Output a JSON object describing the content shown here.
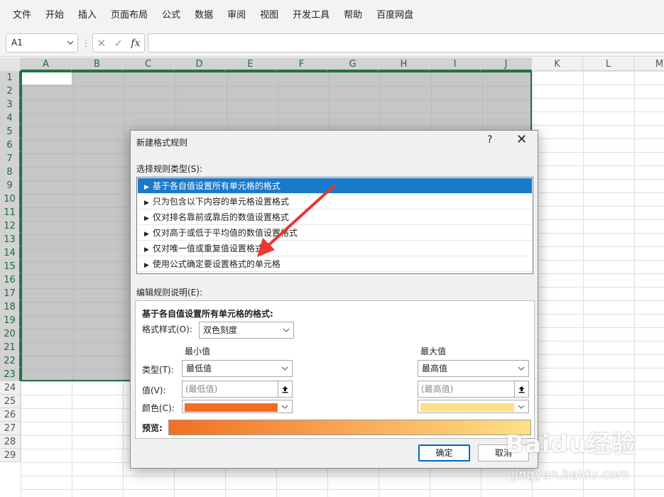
{
  "menubar": {
    "items": [
      "文件",
      "开始",
      "插入",
      "页面布局",
      "公式",
      "数据",
      "审阅",
      "视图",
      "开发工具",
      "帮助",
      "百度网盘"
    ]
  },
  "formulabar": {
    "namebox": "A1",
    "separator": "⋮",
    "cancel_icon": "✕",
    "enter_icon": "✓",
    "fx_label": "fx",
    "formula_value": ""
  },
  "sheet": {
    "columns": [
      "A",
      "B",
      "C",
      "D",
      "E",
      "F",
      "G",
      "H",
      "I",
      "J",
      "K",
      "L",
      "M"
    ],
    "rows": [
      "1",
      "2",
      "3",
      "4",
      "5",
      "6",
      "7",
      "8",
      "9",
      "10",
      "11",
      "12",
      "13",
      "14",
      "15",
      "16",
      "17",
      "18",
      "19",
      "20",
      "21",
      "22",
      "23",
      "24",
      "25",
      "26",
      "27",
      "28",
      "29"
    ],
    "selected_range": "A1:J23"
  },
  "dialog": {
    "title": "新建格式规则",
    "help": "?",
    "close": "✕",
    "rule_type_label": "选择规则类型(S):",
    "rule_types": [
      "基于各自值设置所有单元格的格式",
      "只为包含以下内容的单元格设置格式",
      "仅对排名靠前或靠后的数值设置格式",
      "仅对高于或低于平均值的数值设置格式",
      "仅对唯一值或重复值设置格式",
      "使用公式确定要设置格式的单元格"
    ],
    "selected_rule_index": 0,
    "edit_label": "编辑规则说明(E):",
    "desc_heading": "基于各自值设置所有单元格的格式:",
    "format_style_label": "格式样式(O):",
    "format_style_value": "双色刻度",
    "min_heading": "最小值",
    "max_heading": "最大值",
    "type_label": "类型(T):",
    "value_label": "值(V):",
    "color_label": "颜色(C):",
    "min_type": "最低值",
    "max_type": "最高值",
    "min_value_placeholder": "(最低值)",
    "max_value_placeholder": "(最高值)",
    "min_color": "#f26f22",
    "max_color": "#fde188",
    "preview_label": "预览:",
    "ok_button": "确定",
    "cancel_button": "取消"
  },
  "watermark": {
    "logo": "Baidu经验",
    "url": "jingyan.baidu.com"
  },
  "annotation": {
    "arrow_color": "#e8382f"
  }
}
